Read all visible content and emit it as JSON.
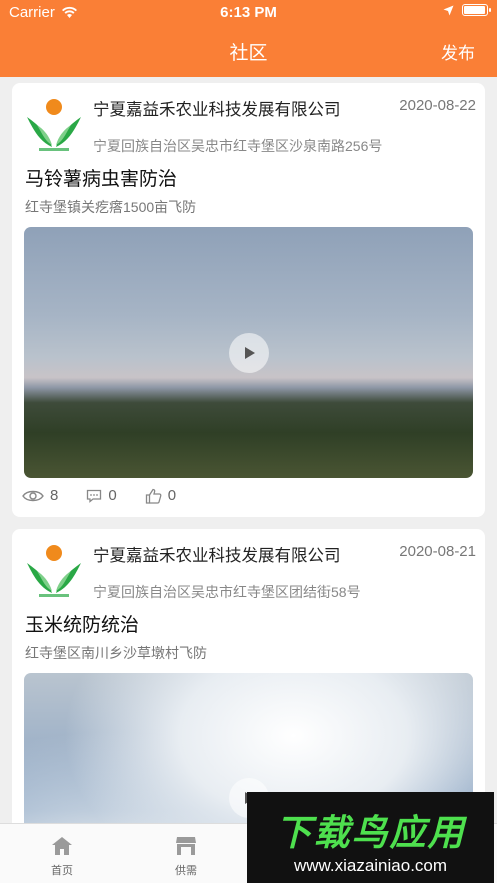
{
  "status_bar": {
    "carrier": "Carrier",
    "time": "6:13 PM",
    "battery_level": 1.0
  },
  "header": {
    "title": "社区",
    "publish_label": "发布"
  },
  "posts": [
    {
      "company": "宁夏嘉益禾农业科技发展有限公司",
      "date": "2020-08-22",
      "address": "宁夏回族自治区吴忠市红寺堡区沙泉南路256号",
      "title": "马铃薯病虫害防治",
      "subtitle": "红寺堡镇关疙瘩1500亩飞防",
      "views": "8",
      "comments": "0",
      "likes": "0"
    },
    {
      "company": "宁夏嘉益禾农业科技发展有限公司",
      "date": "2020-08-21",
      "address": "宁夏回族自治区吴忠市红寺堡区团结街58号",
      "title": "玉米统防统治",
      "subtitle": "红寺堡区南川乡沙草墩村飞防"
    }
  ],
  "tab_bar": {
    "home": "首页",
    "supply": "供需"
  },
  "watermark": {
    "title": "下载鸟应用",
    "url": "www.xiazainiao.com"
  },
  "colors": {
    "brand": "#fa7f36",
    "logo_green": "#2aa846",
    "logo_orange": "#f08a1c"
  }
}
